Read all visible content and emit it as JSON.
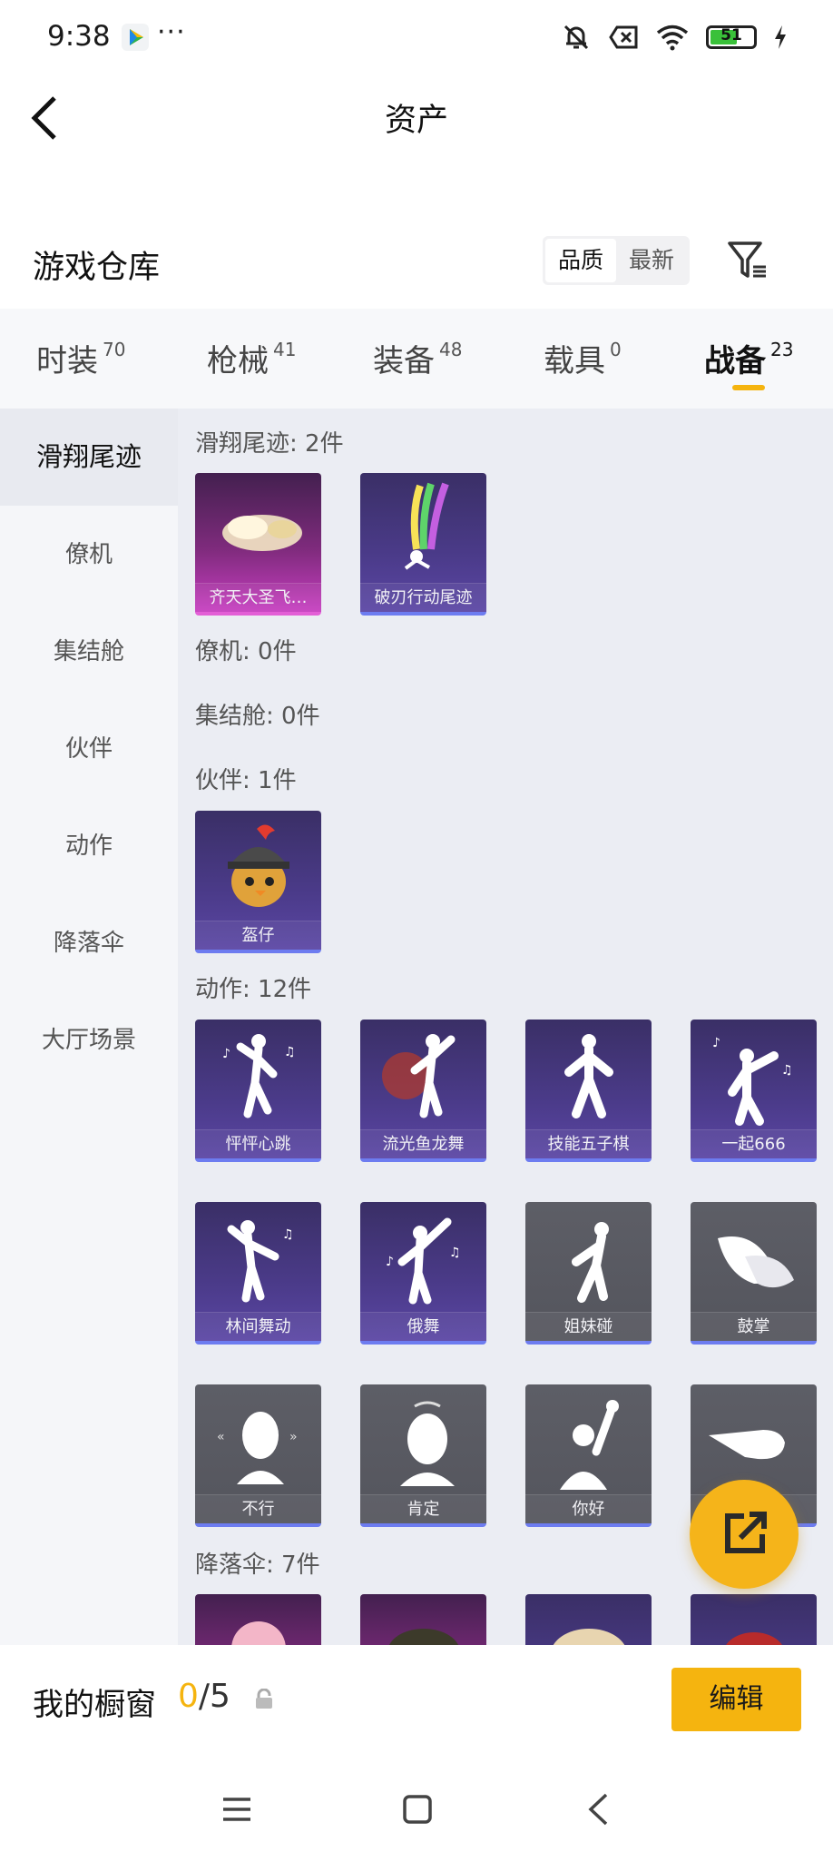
{
  "status_bar": {
    "time": "9:38",
    "dots": "···",
    "battery": "51"
  },
  "header": {
    "title": "资产"
  },
  "warehouse": {
    "title": "游戏仓库",
    "sort_options": [
      "品质",
      "最新"
    ]
  },
  "category_tabs": [
    {
      "label": "时装",
      "count": "70"
    },
    {
      "label": "枪械",
      "count": "41"
    },
    {
      "label": "装备",
      "count": "48"
    },
    {
      "label": "载具",
      "count": "0"
    },
    {
      "label": "战备",
      "count": "23"
    }
  ],
  "side_nav": [
    "滑翔尾迹",
    "僚机",
    "集结舱",
    "伙伴",
    "动作",
    "降落伞",
    "大厅场景"
  ],
  "groups": {
    "glide": {
      "title": "滑翔尾迹: 2件",
      "items": [
        "齐天大圣飞…",
        "破刃行动尾迹"
      ]
    },
    "wingman": {
      "title": "僚机: 0件"
    },
    "pod": {
      "title": "集结舱: 0件"
    },
    "partner": {
      "title": "伙伴: 1件",
      "items": [
        "盔仔"
      ]
    },
    "emote": {
      "title": "动作: 12件",
      "items": [
        "怦怦心跳",
        "流光鱼龙舞",
        "技能五子棋",
        "一起666",
        "林间舞动",
        "俄舞",
        "姐妹碰",
        "鼓掌",
        "不行",
        "肯定",
        "你好"
      ]
    },
    "parachute": {
      "title": "降落伞: 7件"
    }
  },
  "showcase": {
    "label": "我的橱窗",
    "current": "0",
    "total": "/5",
    "edit": "编辑"
  },
  "colors": {
    "accent": "#f5b40f",
    "rare_border": "#6d7cf0",
    "epic_border": "#e35fd6"
  }
}
